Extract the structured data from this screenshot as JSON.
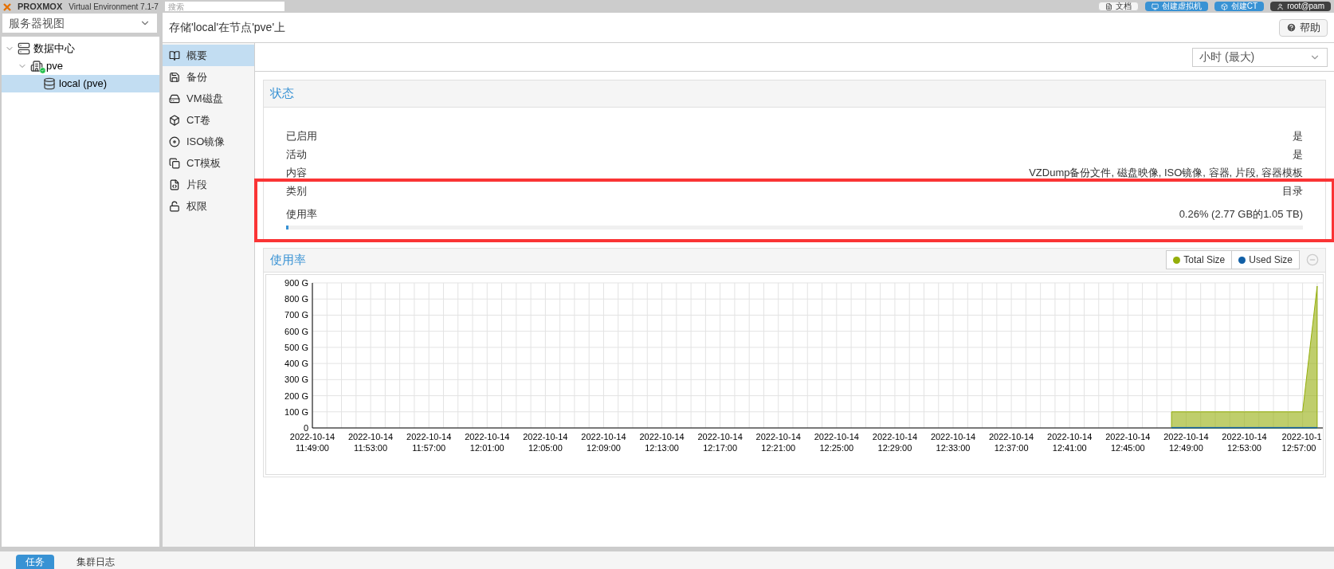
{
  "top_bar": {
    "logo": "PROXMOX",
    "version": "Virtual Environment 7.1-7",
    "search": {
      "placeholder": "搜索"
    },
    "buttons": [
      {
        "kind": "doc",
        "label": "文档"
      },
      {
        "kind": "vm",
        "label": "创建虚拟机"
      },
      {
        "kind": "ct",
        "label": "创建CT"
      },
      {
        "kind": "user",
        "label": "root@pam"
      }
    ]
  },
  "sidebar": {
    "view_select": "服务器视图",
    "tree": [
      {
        "label": "数据中心",
        "kind": "datacenter",
        "expanded": true,
        "selected": false,
        "children": [
          {
            "label": "pve",
            "kind": "node",
            "expanded": true,
            "selected": false,
            "children": [
              {
                "label": "local (pve)",
                "kind": "storage",
                "selected": true
              }
            ]
          }
        ]
      }
    ]
  },
  "header": {
    "title": "存储'local'在节点'pve'上",
    "help": "帮助"
  },
  "nav": [
    {
      "label": "概要",
      "kind": "summary",
      "selected": true
    },
    {
      "label": "备份",
      "kind": "backup",
      "selected": false
    },
    {
      "label": "VM磁盘",
      "kind": "vmdisk",
      "selected": false
    },
    {
      "label": "CT卷",
      "kind": "ctvolume",
      "selected": false
    },
    {
      "label": "ISO镜像",
      "kind": "iso",
      "selected": false
    },
    {
      "label": "CT模板",
      "kind": "template",
      "selected": false
    },
    {
      "label": "片段",
      "kind": "snippet",
      "selected": false
    },
    {
      "label": "权限",
      "kind": "permission",
      "selected": false
    }
  ],
  "timeframe": "小时 (最大)",
  "status": {
    "title": "状态",
    "rows": [
      {
        "label": "已启用",
        "value": "是"
      },
      {
        "label": "活动",
        "value": "是"
      },
      {
        "label": "内容",
        "value": "VZDump备份文件, 磁盘映像, ISO镜像, 容器, 片段, 容器模板"
      },
      {
        "label": "类别",
        "value": "目录"
      }
    ],
    "usage": {
      "label": "使用率",
      "reading": "0.26% (2.77 GB的1.05 TB)",
      "level": 0.0026
    }
  },
  "usage_panel": {
    "title": "使用率",
    "chart_data": {
      "type": "area",
      "categories": [
        "2022-10-14 11:49:00",
        null,
        null,
        null,
        "2022-10-14 11:53:00",
        null,
        null,
        null,
        "2022-10-14 11:57:00",
        null,
        null,
        null,
        "2022-10-14 12:01:00",
        null,
        null,
        null,
        "2022-10-14 12:05:00",
        null,
        null,
        null,
        "2022-10-14 12:09:00",
        null,
        null,
        null,
        "2022-10-14 12:13:00",
        null,
        null,
        null,
        "2022-10-14 12:17:00",
        null,
        null,
        null,
        "2022-10-14 12:21:00",
        null,
        null,
        null,
        "2022-10-14 12:25:00",
        null,
        null,
        null,
        "2022-10-14 12:29:00",
        null,
        null,
        null,
        "2022-10-14 12:33:00",
        null,
        null,
        null,
        "2022-10-14 12:37:00",
        null,
        null,
        null,
        "2022-10-14 12:41:00",
        null,
        null,
        null,
        "2022-10-14 12:45:00",
        null,
        null,
        null,
        "2022-10-14 12:49:00",
        null,
        null,
        null,
        "2022-10-14 12:53:00",
        null,
        null,
        null,
        "2022-10-1 12:57:00",
        null
      ],
      "series": [
        {
          "name": "Total Size",
          "color": "#94ae0a",
          "values": [
            null,
            null,
            null,
            null,
            null,
            null,
            null,
            null,
            null,
            null,
            null,
            null,
            null,
            null,
            null,
            null,
            null,
            null,
            null,
            null,
            null,
            null,
            null,
            null,
            null,
            null,
            null,
            null,
            null,
            null,
            null,
            null,
            null,
            null,
            null,
            null,
            null,
            null,
            null,
            null,
            null,
            null,
            null,
            null,
            null,
            null,
            null,
            null,
            null,
            null,
            null,
            null,
            null,
            null,
            null,
            null,
            null,
            null,
            null,
            100,
            100,
            100,
            100,
            100,
            100,
            100,
            100,
            100,
            100,
            880
          ]
        },
        {
          "name": "Used Size",
          "color": "#115fa6",
          "values": [
            null,
            null,
            null,
            null,
            null,
            null,
            null,
            null,
            null,
            null,
            null,
            null,
            null,
            null,
            null,
            null,
            null,
            null,
            null,
            null,
            null,
            null,
            null,
            null,
            null,
            null,
            null,
            null,
            null,
            null,
            null,
            null,
            null,
            null,
            null,
            null,
            null,
            null,
            null,
            null,
            null,
            null,
            null,
            null,
            null,
            null,
            null,
            null,
            null,
            null,
            null,
            null,
            null,
            null,
            null,
            null,
            null,
            null,
            null,
            3,
            3,
            3,
            3,
            3,
            3,
            3,
            3,
            3,
            3,
            3
          ]
        }
      ],
      "ylim": [
        0,
        900
      ],
      "grid": true,
      "yticks": [
        {
          "value": 0,
          "label": "0"
        },
        {
          "value": 100,
          "label": "100 G"
        },
        {
          "value": 200,
          "label": "200 G"
        },
        {
          "value": 300,
          "label": "300 G"
        },
        {
          "value": 400,
          "label": "400 G"
        },
        {
          "value": 500,
          "label": "500 G"
        },
        {
          "value": 600,
          "label": "600 G"
        },
        {
          "value": 700,
          "label": "700 G"
        },
        {
          "value": 800,
          "label": "800 G"
        },
        {
          "value": 900,
          "label": "900 G"
        }
      ]
    }
  },
  "log_tabs": [
    {
      "label": "任务",
      "selected": true
    },
    {
      "label": "集群日志",
      "selected": false
    }
  ]
}
